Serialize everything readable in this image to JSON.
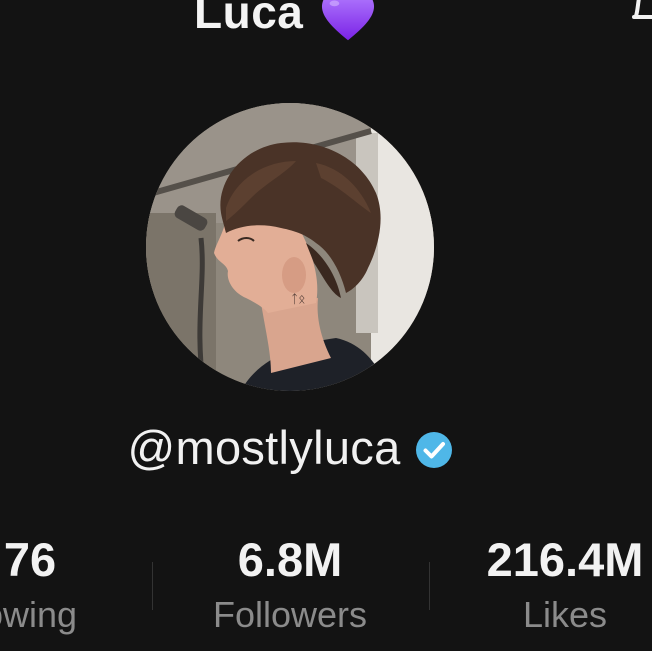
{
  "profile": {
    "display_name": "Luca",
    "name_emoji_icon": "purple-heart-icon",
    "username": "@mostlyluca",
    "verified_icon": "verified-badge-icon",
    "avatar_alt": "profile photo"
  },
  "header": {
    "notification_icon": "bell-icon"
  },
  "stats": [
    {
      "value": "76",
      "label": "owing"
    },
    {
      "value": "6.8M",
      "label": "Followers"
    },
    {
      "value": "216.4M",
      "label": "Likes"
    }
  ],
  "colors": {
    "background": "#131313",
    "text_primary": "#f2f2f2",
    "text_secondary": "#8b8b8b",
    "verified_blue": "#4fb7e8",
    "heart_purple": "#8a3ff0"
  }
}
